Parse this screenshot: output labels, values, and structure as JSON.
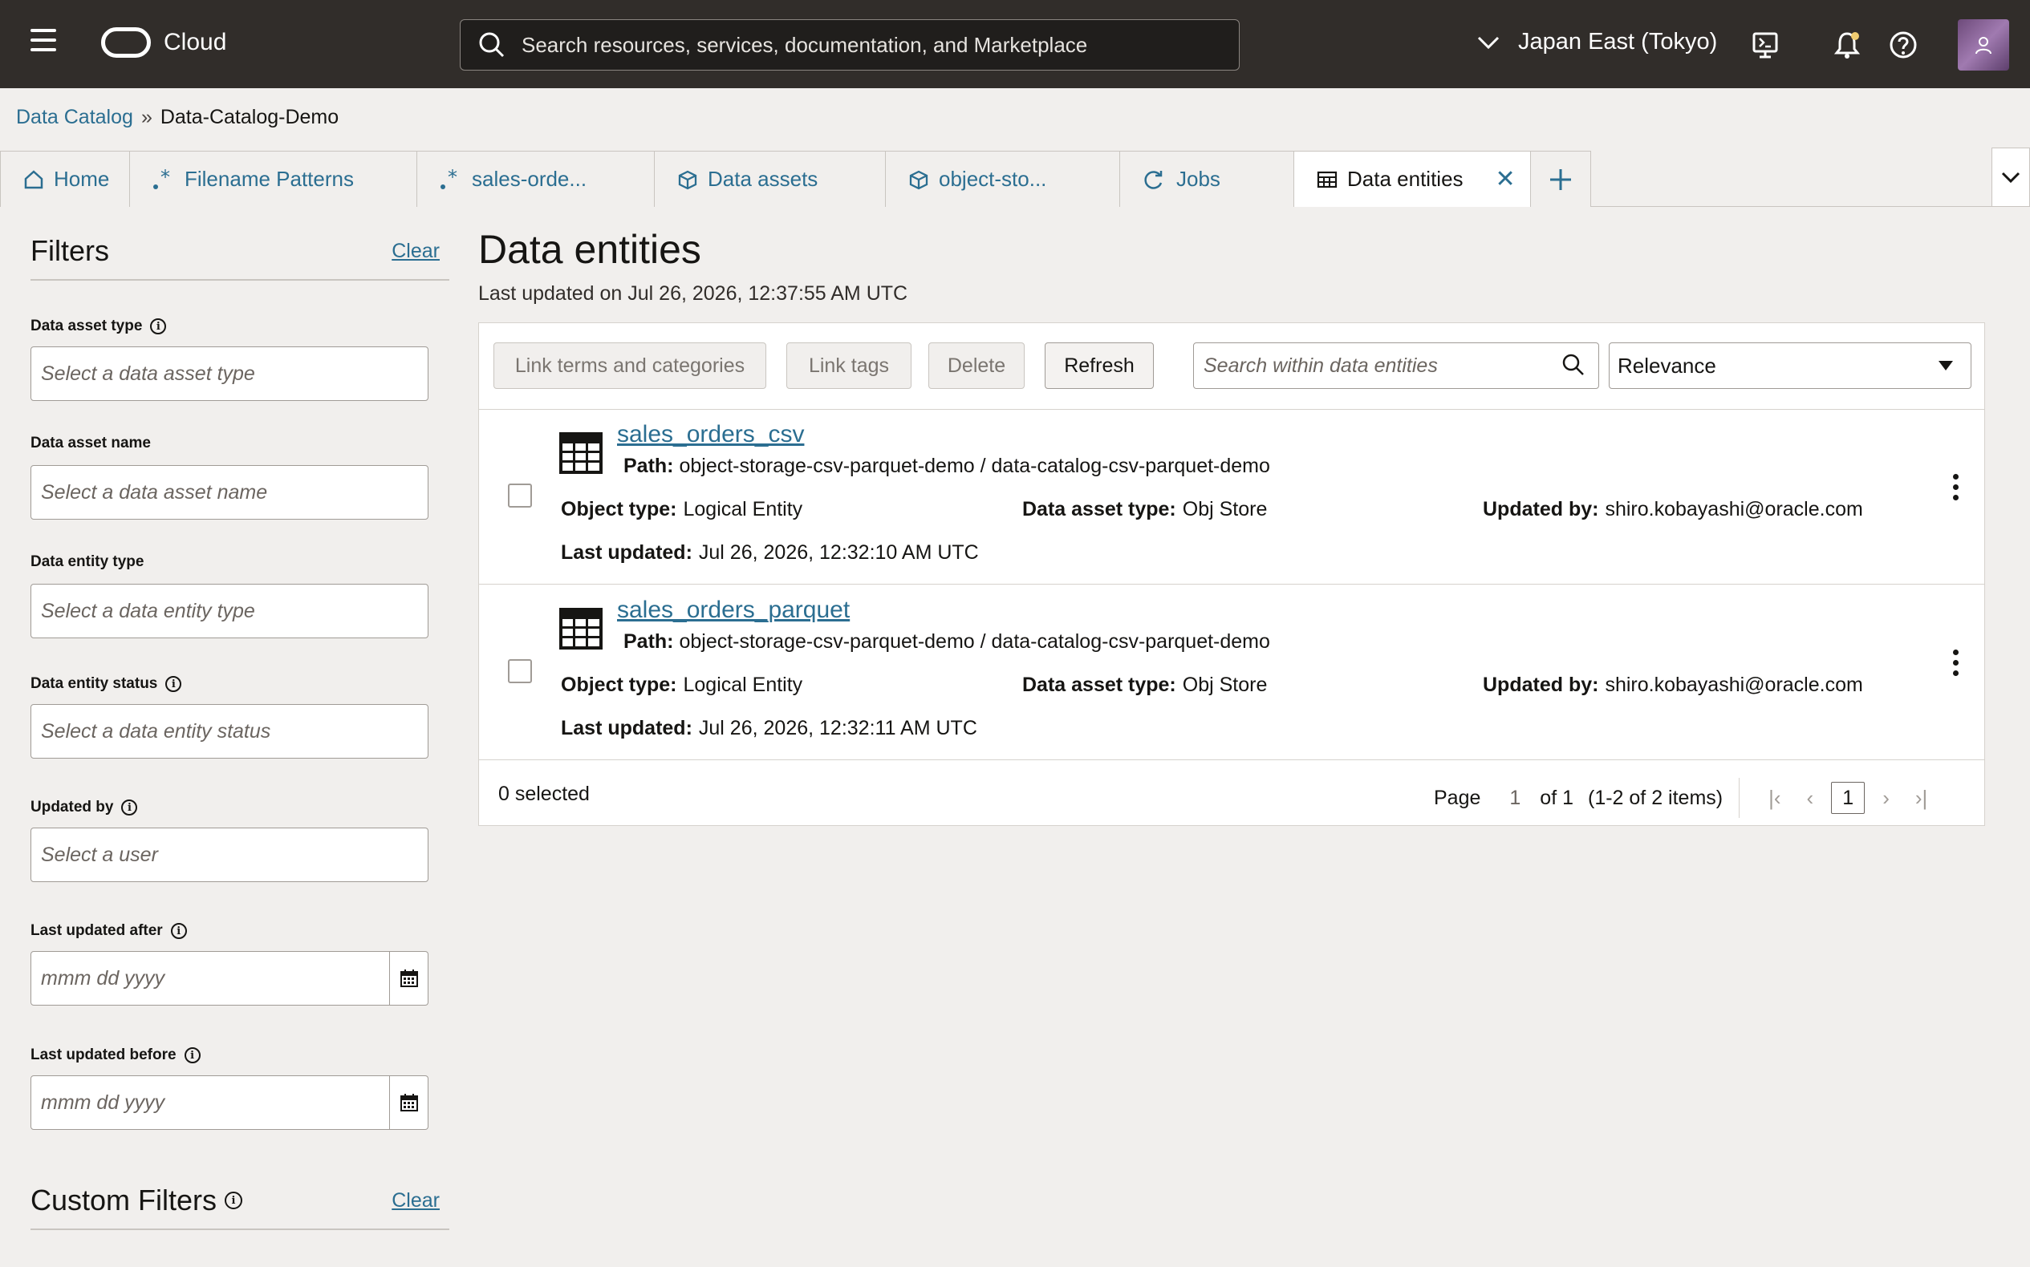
{
  "topbar": {
    "brand": "Cloud",
    "search_placeholder": "Search resources, services, documentation, and Marketplace",
    "region": "Japan East (Tokyo)"
  },
  "breadcrumb": {
    "root": "Data Catalog",
    "separator": "»",
    "current": "Data-Catalog-Demo"
  },
  "tabs": [
    {
      "label": "Home",
      "icon": "home-icon"
    },
    {
      "label": "Filename Patterns",
      "icon": "pattern-icon"
    },
    {
      "label": "sales-orde...",
      "icon": "pattern-icon"
    },
    {
      "label": "Data assets",
      "icon": "cube-icon"
    },
    {
      "label": "object-sto...",
      "icon": "cube-icon"
    },
    {
      "label": "Jobs",
      "icon": "refresh-icon"
    },
    {
      "label": "Data entities",
      "icon": "table-icon",
      "active": true
    }
  ],
  "filters": {
    "title": "Filters",
    "clear": "Clear",
    "fields": [
      {
        "label": "Data asset type",
        "placeholder": "Select a data asset type",
        "info": true
      },
      {
        "label": "Data asset name",
        "placeholder": "Select a data asset name",
        "info": false
      },
      {
        "label": "Data entity type",
        "placeholder": "Select a data entity type",
        "info": false
      },
      {
        "label": "Data entity status",
        "placeholder": "Select a data entity status",
        "info": true
      },
      {
        "label": "Updated by",
        "placeholder": "Select a user",
        "info": true
      },
      {
        "label": "Last updated after",
        "placeholder": "mmm dd yyyy",
        "info": true
      },
      {
        "label": "Last updated before",
        "placeholder": "mmm dd yyyy",
        "info": true
      }
    ],
    "custom_title": "Custom Filters",
    "custom_clear": "Clear"
  },
  "main": {
    "title": "Data entities",
    "subtitle": "Last updated on Jul 26, 2026, 12:37:55 AM UTC",
    "toolbar": {
      "link_terms": "Link terms and categories",
      "link_tags": "Link tags",
      "delete": "Delete",
      "refresh": "Refresh",
      "search_placeholder": "Search within data entities",
      "sort": "Relevance"
    },
    "labels": {
      "path": "Path:",
      "object_type": "Object type:",
      "data_asset_type": "Data asset type:",
      "updated_by": "Updated by:",
      "last_updated": "Last updated:"
    },
    "entities": [
      {
        "name": "sales_orders_csv",
        "path": "object-storage-csv-parquet-demo / data-catalog-csv-parquet-demo",
        "object_type": "Logical Entity",
        "data_asset_type": "Obj Store",
        "updated_by": "shiro.kobayashi@oracle.com",
        "last_updated": "Jul 26, 2026, 12:32:10 AM UTC"
      },
      {
        "name": "sales_orders_parquet",
        "path": "object-storage-csv-parquet-demo / data-catalog-csv-parquet-demo",
        "object_type": "Logical Entity",
        "data_asset_type": "Obj Store",
        "updated_by": "shiro.kobayashi@oracle.com",
        "last_updated": "Jul 26, 2026, 12:32:11 AM UTC"
      }
    ],
    "footer": {
      "selected": "0 selected",
      "page_label": "Page",
      "page_value": "1",
      "of": "of 1",
      "items": "(1-2 of 2 items)",
      "current_page": "1"
    }
  },
  "colors": {
    "topbar": "#312d2a",
    "link": "#2b6e91",
    "background": "#f1efed"
  }
}
